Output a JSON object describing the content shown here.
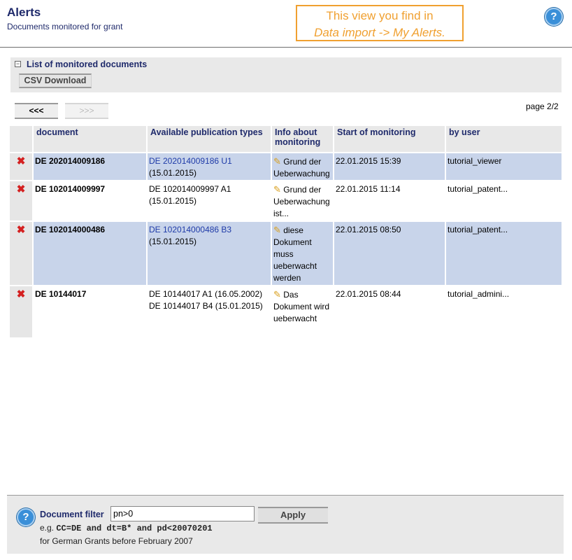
{
  "header": {
    "title": "Alerts",
    "subtitle": "Documents monitored for grant",
    "hint_line1": "This view you find in",
    "hint_line2": "Data import -> My Alerts."
  },
  "panel": {
    "title": "List of monitored documents",
    "csv_button": "CSV Download"
  },
  "pager": {
    "prev_label": "<<<",
    "next_label": ">>>",
    "page_text": "page 2/2"
  },
  "table": {
    "columns": [
      "document",
      "Available publication types",
      "Info about monitoring",
      "Start of monitoring",
      "by user"
    ],
    "rows": [
      {
        "document": "DE 202014009186",
        "pub_line1": "DE 202014009186 U1",
        "pub_line2": "(15.01.2015)",
        "info": "Grund der Ueberwachung",
        "start": "22.01.2015 15:39",
        "user": "tutorial_viewer"
      },
      {
        "document": "DE 102014009997",
        "pub_line1": "DE 102014009997 A1",
        "pub_line2": "(15.01.2015)",
        "info": "Grund der Ueberwachung ist...",
        "start": "22.01.2015 11:14",
        "user": "tutorial_patent..."
      },
      {
        "document": "DE 102014000486",
        "pub_line1": "DE 102014000486 B3",
        "pub_line2": "(15.01.2015)",
        "info": "diese Dokument muss ueberwacht werden",
        "start": "22.01.2015 08:50",
        "user": "tutorial_patent..."
      },
      {
        "document": "DE 10144017",
        "pub_line1": "DE 10144017 A1 (16.05.2002)",
        "pub_line2": "DE 10144017 B4 (15.01.2015)",
        "info": "Das Dokument wird ueberwacht",
        "start": "22.01.2015 08:44",
        "user": "tutorial_admini..."
      }
    ]
  },
  "filter": {
    "label": "Document filter",
    "value": "pn>0",
    "apply_label": "Apply",
    "example_prefix": "e.g.",
    "example_code": "CC=DE and dt=B* and pd<20070201",
    "example_desc": "for German Grants before February 2007"
  },
  "icons": {
    "help": "help-icon",
    "delete": "delete-x-icon",
    "edit": "pencil-icon"
  },
  "colors": {
    "brand_text": "#1f2a6b",
    "highlight_row": "#c8d4ea",
    "hint_border": "#f0a030",
    "delete_red": "#d42020"
  }
}
